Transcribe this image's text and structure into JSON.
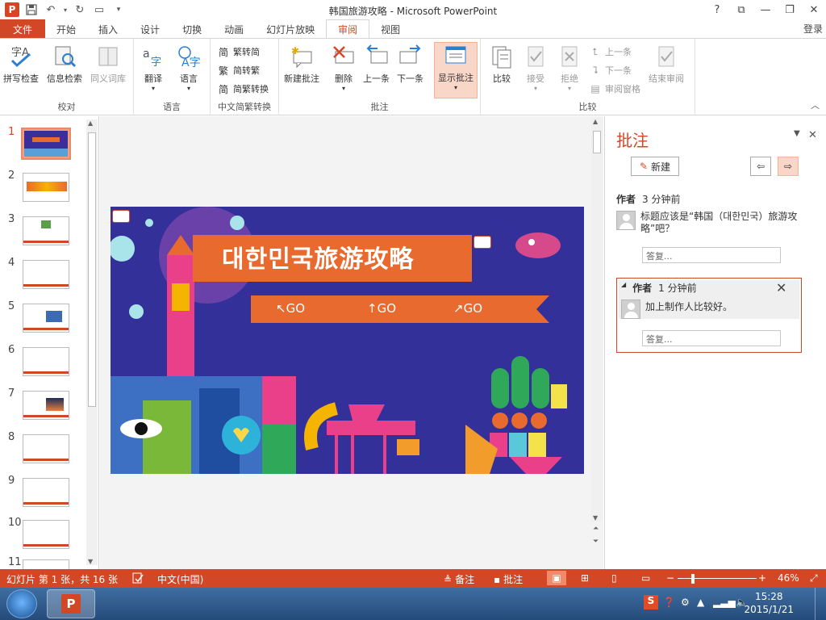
{
  "window": {
    "title": "韩国旅游攻略 - Microsoft PowerPoint",
    "controls": [
      "?",
      "⧉",
      "—",
      "❐",
      "✕"
    ],
    "login": "登录"
  },
  "tabs": [
    {
      "label": "文件"
    },
    {
      "label": "开始"
    },
    {
      "label": "插入"
    },
    {
      "label": "设计"
    },
    {
      "label": "切换"
    },
    {
      "label": "动画"
    },
    {
      "label": "幻灯片放映"
    },
    {
      "label": "审阅"
    },
    {
      "label": "视图"
    }
  ],
  "ribbon": {
    "proofing": {
      "label": "校对",
      "spell": "拼写检查",
      "research": "信息检索",
      "thesaurus": "同义词库"
    },
    "language": {
      "label": "语言",
      "translate": "翻译",
      "language": "语言"
    },
    "chinese": {
      "label": "中文简繁转换",
      "to_simplified": "繁转简",
      "to_traditional": "简转繁",
      "convert": "简繁转换"
    },
    "comments": {
      "label": "批注",
      "new": "新建批注",
      "delete": "删除",
      "prev": "上一条",
      "next": "下一条",
      "show": "显示批注"
    },
    "compare": {
      "label": "比较",
      "compare": "比较",
      "accept": "接受",
      "reject": "拒绝",
      "prev": "上一条",
      "next": "下一条",
      "pane": "审阅窗格",
      "end": "结束审阅"
    }
  },
  "thumbnails": [
    {
      "num": "1"
    },
    {
      "num": "2"
    },
    {
      "num": "3"
    },
    {
      "num": "4"
    },
    {
      "num": "5"
    },
    {
      "num": "6"
    },
    {
      "num": "7"
    },
    {
      "num": "8"
    },
    {
      "num": "9"
    },
    {
      "num": "10"
    },
    {
      "num": "11"
    }
  ],
  "slide": {
    "title": "대한민국旅游攻略",
    "go1": "↖GO",
    "go2": "↑GO",
    "go3": "↗GO"
  },
  "comments_pane": {
    "title": "批注",
    "new_button": "新建",
    "comments": [
      {
        "author": "作者",
        "time": "3 分钟前",
        "text": "标题应该是“韩国（대한민국）旅游攻略”吧？",
        "reply_placeholder": "答复..."
      },
      {
        "author": "作者",
        "time": "1 分钟前",
        "text": "加上制作人比较好。",
        "reply_placeholder": "答复..."
      }
    ]
  },
  "status": {
    "slide_info": "幻灯片 第 1 张，共 16 张",
    "language": "中文(中国)",
    "notes": "备注",
    "comments": "批注",
    "zoom": "46%"
  },
  "taskbar": {
    "time": "15:28",
    "date": "2015/1/21"
  },
  "colors": {
    "accent": "#d24726",
    "slide_bg": "#33309a"
  }
}
